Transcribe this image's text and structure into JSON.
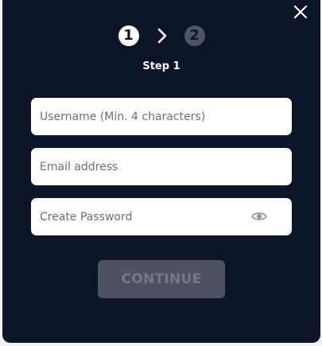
{
  "stepper": {
    "step1_number": "1",
    "step2_number": "2",
    "current_step_label": "Step 1"
  },
  "form": {
    "username_placeholder": "Username (Min. 4 characters)",
    "email_placeholder": "Email address",
    "password_placeholder": "Create Password",
    "continue_label": "CONTINUE"
  },
  "icons": {
    "close": "close-icon",
    "arrow": "chevron-right-icon",
    "password_toggle": "eye-icon"
  },
  "colors": {
    "modal_background": "#0c1528",
    "field_background": "#ffffff",
    "step_active": "#ffffff",
    "step_inactive": "#4d5566",
    "button_disabled_background": "#4b5262",
    "button_disabled_text": "#727a8a"
  }
}
